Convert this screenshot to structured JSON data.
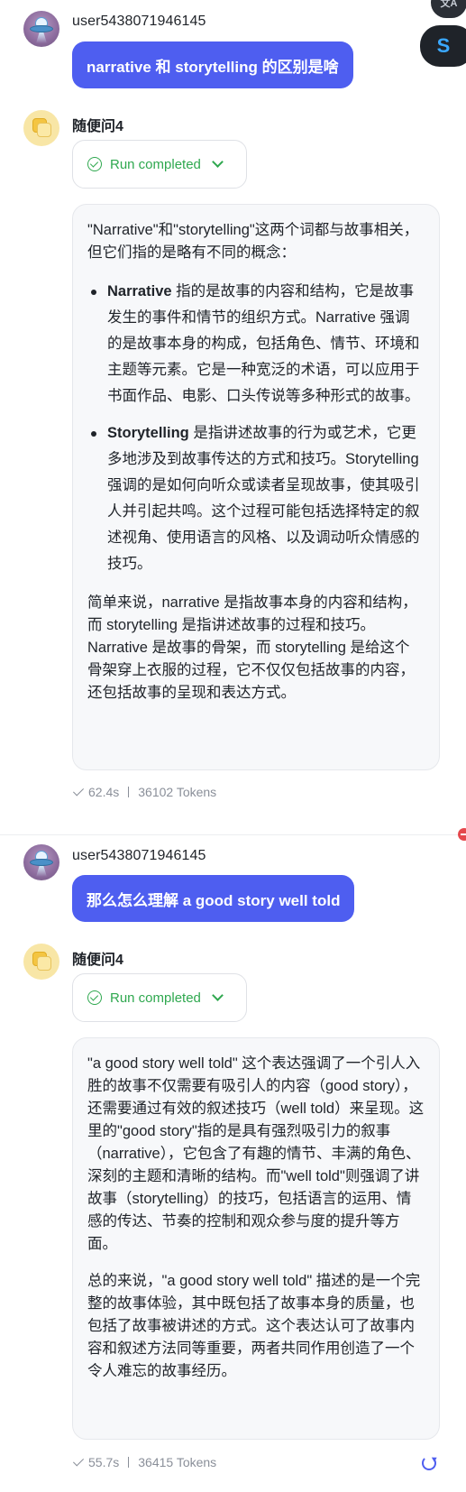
{
  "floating": {
    "translate_icon": "translate-icon",
    "assistant_icon": "assistant-icon",
    "translate_glyph": "文A",
    "assistant_glyph": "S"
  },
  "colors": {
    "accent": "#4e5ef0",
    "success": "#2fa84f",
    "card_bg": "#f7f8fa",
    "meta_text": "#8a8f99"
  },
  "conversation": [
    {
      "user": {
        "username": "user5438071946145",
        "message": "narrative 和 storytelling 的区别是啥"
      },
      "bot": {
        "name": "随便问4",
        "status": "Run completed",
        "intro": "\"Narrative\"和\"storytelling\"这两个词都与故事相关，但它们指的是略有不同的概念：",
        "bullets": [
          {
            "term": "Narrative",
            "text": " 指的是故事的内容和结构，它是故事发生的事件和情节的组织方式。Narrative 强调的是故事本身的构成，包括角色、情节、环境和主题等元素。它是一种宽泛的术语，可以应用于书面作品、电影、口头传说等多种形式的故事。"
          },
          {
            "term": "Storytelling",
            "text": " 是指讲述故事的行为或艺术，它更多地涉及到故事传达的方式和技巧。Storytelling 强调的是如何向听众或读者呈现故事，使其吸引人并引起共鸣。这个过程可能包括选择特定的叙述视角、使用语言的风格、以及调动听众情感的技巧。"
          }
        ],
        "conclusion_pre": "简单来说，narrative 是指故事本身的内容和结构，而 storytelling 是指讲述故事的过程和技巧。Narrative 是故事的骨架，而 storytelling 是给这个骨架穿上衣服的过程，它不仅仅包括故事的内容，还包括故事的呈现和表达方式。",
        "time": "62.4s",
        "tokens": "36102 Tokens"
      }
    },
    {
      "user": {
        "username": "user5438071946145",
        "message": "那么怎么理解 a good story well told"
      },
      "bot": {
        "name": "随便问4",
        "status": "Run completed",
        "para1": "\"a good story well told\" 这个表达强调了一个引人入胜的故事不仅需要有吸引人的内容（good story），还需要通过有效的叙述技巧（well told）来呈现。这里的\"good story\"指的是具有强烈吸引力的叙事（narrative），它包含了有趣的情节、丰满的角色、深刻的主题和清晰的结构。而\"well told\"则强调了讲故事（storytelling）的技巧，包括语言的运用、情感的传达、节奏的控制和观众参与度的提升等方面。",
        "para2": "总的来说，\"a good story well told\" 描述的是一个完整的故事体验，其中既包括了故事本身的质量，也包括了故事被讲述的方式。这个表达认可了故事内容和叙述方法同等重要，两者共同作用创造了一个令人难忘的故事经历。",
        "time": "55.7s",
        "tokens": "36415 Tokens"
      }
    }
  ]
}
